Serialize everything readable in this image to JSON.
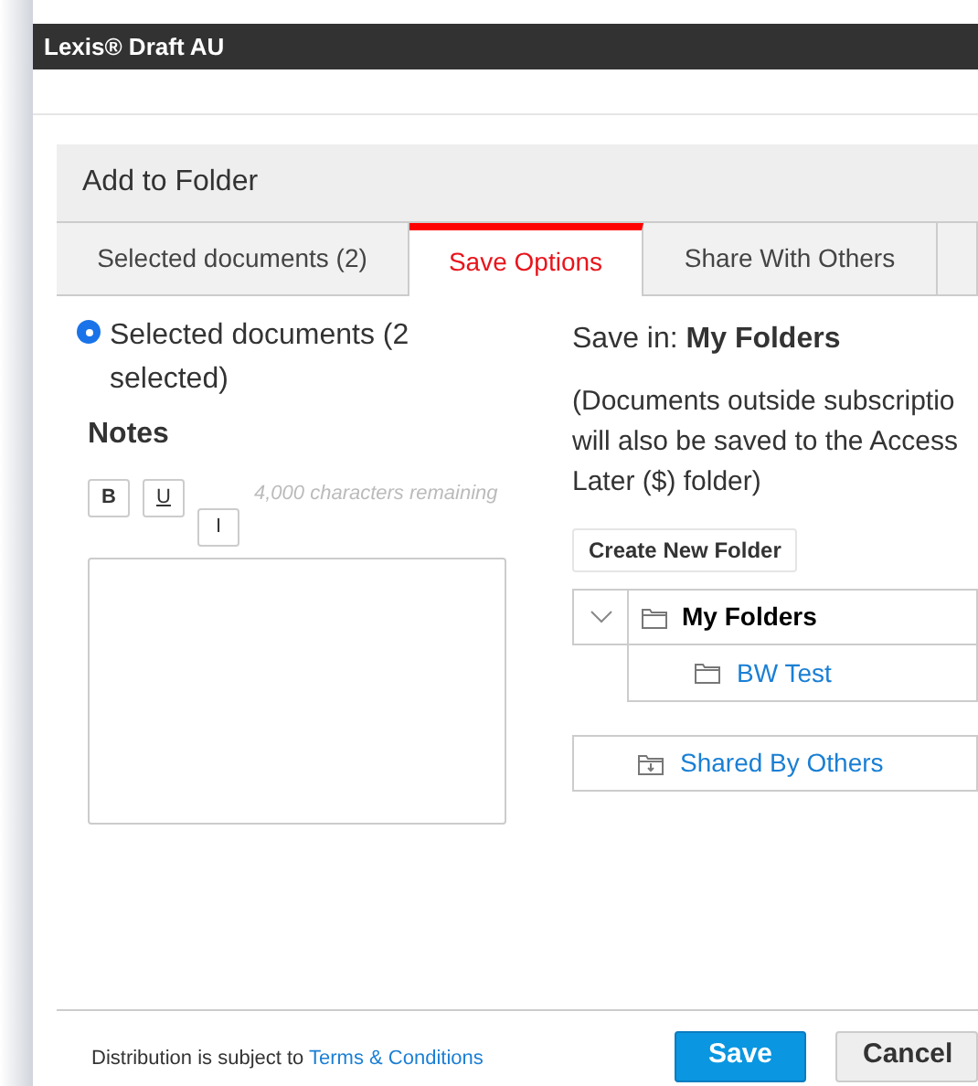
{
  "window": {
    "title": "Lexis® Draft AU"
  },
  "dialog": {
    "title": "Add to Folder"
  },
  "tabs": [
    {
      "label": "Selected documents (2)",
      "selected": false
    },
    {
      "label": "Save Options",
      "selected": true
    },
    {
      "label": "Share With Others",
      "selected": false
    },
    {
      "selected": false
    }
  ],
  "scope": {
    "label": "Selected documents (2 selected)",
    "selected": true
  },
  "notes": {
    "heading": "Notes",
    "format_buttons": [
      "B",
      "U",
      "I"
    ],
    "remaining": "4,000 characters remaining"
  },
  "save_in": {
    "label": "Save in: **My Folders**",
    "note_lines": [
      "(Documents outside subscriptio",
      "will also be saved to the Access",
      "Later ($) folder)"
    ]
  },
  "create_button": "Create New Folder",
  "tree": [
    {
      "label": "My Folders",
      "expanded": true,
      "children": [
        {
          "label": "BW Test"
        }
      ]
    }
  ],
  "shared": {
    "label": "Shared By Others"
  },
  "footer": {
    "text": "Distribution is subject to",
    "link": "Terms & Conditions",
    "buttons": [
      {
        "label": "Save",
        "kind": "primary"
      },
      {
        "label": "Cancel",
        "kind": "secondary"
      }
    ]
  }
}
